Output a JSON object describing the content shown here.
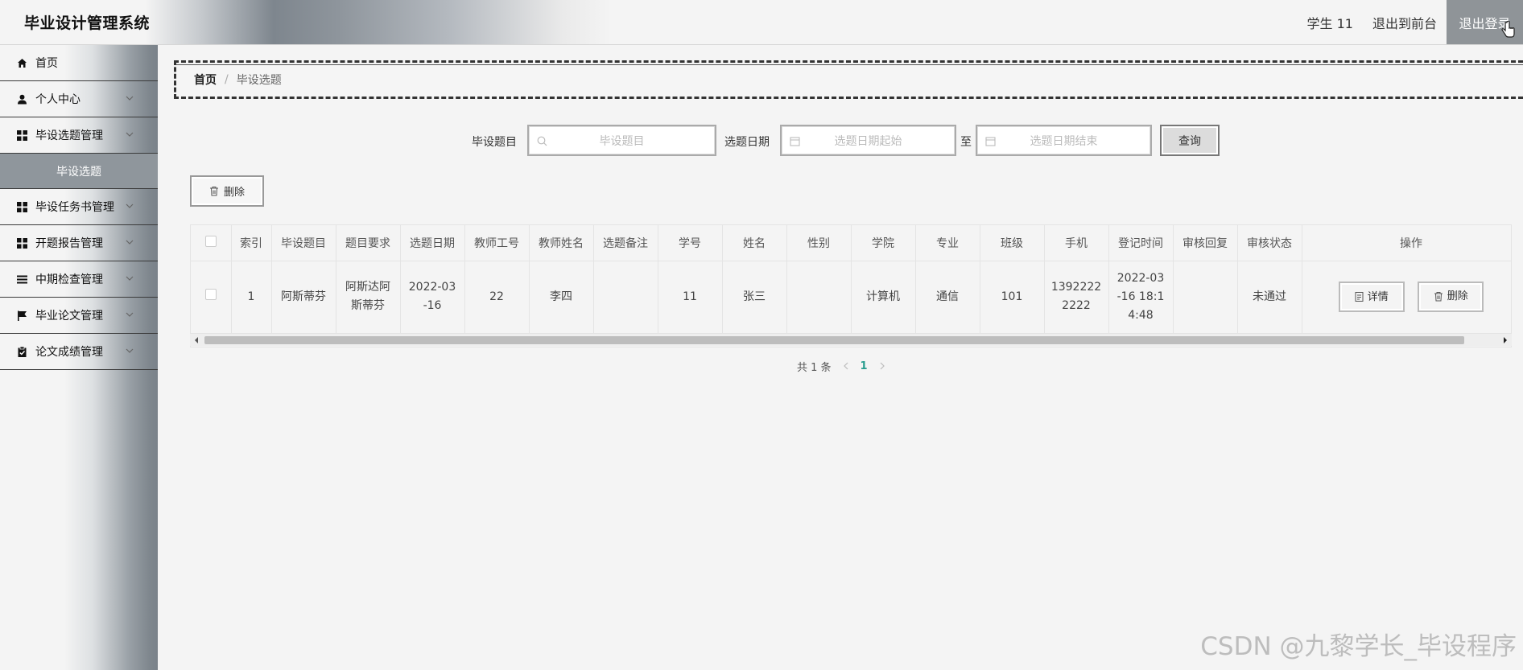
{
  "header": {
    "title": "毕业设计管理系统",
    "user": "学生 11",
    "front": "退出到前台",
    "logout": "退出登录"
  },
  "sidebar": {
    "items": [
      {
        "label": "首页",
        "icon": "home-icon"
      },
      {
        "label": "个人中心",
        "icon": "user-icon"
      },
      {
        "label": "毕设选题管理",
        "icon": "grid-icon"
      },
      {
        "label": "毕设选题",
        "icon": "",
        "sub": true
      },
      {
        "label": "毕设任务书管理",
        "icon": "grid-icon"
      },
      {
        "label": "开题报告管理",
        "icon": "grid-icon"
      },
      {
        "label": "中期检查管理",
        "icon": "list-icon"
      },
      {
        "label": "毕业论文管理",
        "icon": "flag-icon"
      },
      {
        "label": "论文成绩管理",
        "icon": "clipboard-icon"
      }
    ]
  },
  "breadcrumb": {
    "home": "首页",
    "sep": "/",
    "current": "毕设选题"
  },
  "search": {
    "topic_label": "毕设题目",
    "topic_placeholder": "毕设题目",
    "date_label": "选题日期",
    "start_placeholder": "选题日期起始",
    "to": "至",
    "end_placeholder": "选题日期结束",
    "query": "查询"
  },
  "toolbar": {
    "delete": "删除"
  },
  "table": {
    "columns": [
      "索引",
      "毕设题目",
      "题目要求",
      "选题日期",
      "教师工号",
      "教师姓名",
      "选题备注",
      "学号",
      "姓名",
      "性别",
      "学院",
      "专业",
      "班级",
      "手机",
      "登记时间",
      "审核回复",
      "审核状态",
      "操作"
    ],
    "rows": [
      [
        "1",
        "阿斯蒂芬",
        "阿斯达阿斯蒂芬",
        "2022-03-16",
        "22",
        "李四",
        "",
        "11",
        "张三",
        "",
        "计算机",
        "通信",
        "101",
        "13922222222",
        "2022-03-16 18:14:48",
        "",
        "未通过"
      ]
    ],
    "detail": "详情",
    "delete": "删除"
  },
  "pager": {
    "total": "共 1 条",
    "page": "1"
  },
  "watermark": "CSDN @九黎学长_毕设程序"
}
